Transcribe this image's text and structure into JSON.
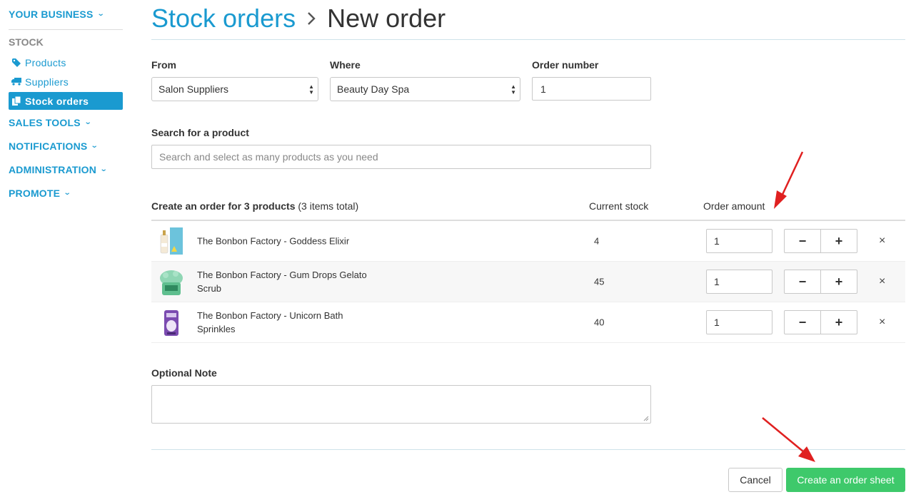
{
  "sidebar": {
    "your_business": "YOUR BUSINESS",
    "stock_label": "STOCK",
    "items": [
      {
        "label": "Products",
        "icon": "tag-icon"
      },
      {
        "label": "Suppliers",
        "icon": "truck-icon"
      },
      {
        "label": "Stock orders",
        "icon": "documents-icon",
        "active": true
      }
    ],
    "sections": [
      "SALES TOOLS",
      "NOTIFICATIONS",
      "ADMINISTRATION",
      "PROMOTE"
    ]
  },
  "header": {
    "breadcrumb": "Stock orders",
    "separator": "›",
    "title": "New order"
  },
  "form": {
    "from_label": "From",
    "from_value": "Salon Suppliers",
    "where_label": "Where",
    "where_value": "Beauty Day Spa",
    "order_number_label": "Order number",
    "order_number_value": "1",
    "search_label": "Search for a product",
    "search_placeholder": "Search and select as many products as you need",
    "note_label": "Optional Note"
  },
  "table": {
    "heading_bold": "Create an order for 3 products",
    "heading_rest": "(3 items total)",
    "col_stock": "Current stock",
    "col_amount": "Order amount",
    "rows": [
      {
        "name": "The Bonbon Factory - Goddess Elixir",
        "stock": "4",
        "amount": "1"
      },
      {
        "name": "The Bonbon Factory - Gum Drops Gelato Scrub",
        "stock": "45",
        "amount": "1"
      },
      {
        "name": "The Bonbon Factory - Unicorn Bath Sprinkles",
        "stock": "40",
        "amount": "1"
      }
    ],
    "minus": "−",
    "plus": "+",
    "remove": "×"
  },
  "footer": {
    "cancel": "Cancel",
    "create": "Create an order sheet"
  },
  "colors": {
    "accent": "#1a9ad0",
    "primary_button": "#3ec96b",
    "annotation_arrow": "#e02020"
  }
}
